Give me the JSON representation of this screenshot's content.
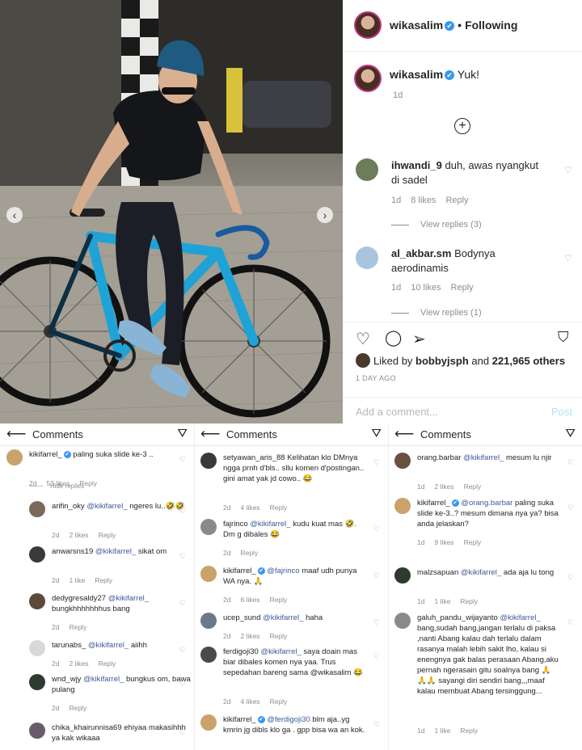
{
  "post": {
    "username": "wikasalim",
    "verified_glyph": "✔",
    "dot": "•",
    "following_label": "Following",
    "caption_text": "Yuk!",
    "caption_time": "1d",
    "load_more_glyph": "+",
    "comments": [
      {
        "user": "ihwandi_9",
        "text": "duh, awas nyangkut di sadel",
        "time": "1d",
        "likes": "8 likes",
        "reply": "Reply",
        "replies": "View replies (3)",
        "avatar_color": "#6b7d5a"
      },
      {
        "user": "al_akbar.sm",
        "text": "Bodynya aerodinamis",
        "time": "1d",
        "likes": "10 likes",
        "reply": "Reply",
        "replies": "View replies (1)",
        "avatar_color": "#a9c4de"
      }
    ],
    "liked_by_prefix": "Liked by",
    "liked_by_user": "bobbyjsph",
    "liked_by_and": "and",
    "liked_by_count": "221,965 others",
    "time_ago": "1 DAY AGO",
    "add_comment_placeholder": "Add a comment...",
    "post_button": "Post"
  },
  "carousel": {
    "prev": "‹",
    "next": "›"
  },
  "icons": {
    "heart": "heart-icon",
    "comment": "comment-icon",
    "share": "share-icon",
    "save": "bookmark-icon",
    "back": "back-arrow-icon",
    "send": "direct-send-icon"
  },
  "panels": [
    {
      "title": "Comments",
      "hide_replies": "Hide replies",
      "comments": [
        {
          "user": "kikifarrel_",
          "verified": true,
          "mention": "",
          "text": "paling suka slide ke-3 ..",
          "time": "2d",
          "likes": "53 likes",
          "reply": "Reply",
          "avatar_color": "#c9a36b"
        },
        {
          "user": "arifin_oky",
          "verified": false,
          "mention": "@kikifarrel_",
          "text": "ngeres lu..🤣🤣",
          "time": "2d",
          "likes": "2 likes",
          "reply": "Reply",
          "avatar_color": "#7a6a5a"
        },
        {
          "user": "anwarsns19",
          "verified": false,
          "mention": "@kikifarrel_",
          "text": "sikat om",
          "time": "2d",
          "likes": "1 like",
          "reply": "Reply",
          "avatar_color": "#3a3a3a"
        },
        {
          "user": "dedygresaldy27",
          "verified": false,
          "mention": "@kikifarrel_",
          "text": "bungkhhhhhhhus bang",
          "time": "2d",
          "likes": "",
          "reply": "Reply",
          "avatar_color": "#5a4a3a"
        },
        {
          "user": "tarunabs_",
          "verified": false,
          "mention": "@kikifarrel_",
          "text": "aiihh",
          "time": "2d",
          "likes": "2 likes",
          "reply": "Reply",
          "avatar_color": "#d8d8d8"
        },
        {
          "user": "wnd_wjy",
          "verified": false,
          "mention": "@kikifarrel_",
          "text": "bungkus om, bawa pulang",
          "time": "2d",
          "likes": "",
          "reply": "Reply",
          "avatar_color": "#2f3a2f"
        },
        {
          "user": "chika_khairunnisa69",
          "verified": false,
          "mention": "",
          "text": "ehiyaa makasihhh ya kak wikaaa",
          "time": "",
          "likes": "",
          "reply": "",
          "avatar_color": "#6a5a6a"
        }
      ]
    },
    {
      "title": "Comments",
      "comments": [
        {
          "user": "setyawan_aris_88",
          "verified": false,
          "mention": "",
          "text": "Kelihatan klo DMnya ngga prnh d'bls.. sllu komen d'postingan.. gini amat yak jd cowo.. 😂",
          "time": "2d",
          "likes": "4 likes",
          "reply": "Reply",
          "avatar_color": "#3a3a3a"
        },
        {
          "user": "fajrinco",
          "verified": false,
          "mention": "@kikifarrel_",
          "text": "kudu kuat mas 🤣. Dm g dibales 😂",
          "time": "2d",
          "likes": "",
          "reply": "Reply",
          "avatar_color": "#8a8a8a"
        },
        {
          "user": "kikifarrel_",
          "verified": true,
          "mention": "@fajrinco",
          "text": "maaf udh punya WA nya. 🙏",
          "time": "2d",
          "likes": "6 likes",
          "reply": "Reply",
          "avatar_color": "#c9a36b"
        },
        {
          "user": "ucep_sund",
          "verified": false,
          "mention": "@kikifarrel_",
          "text": "haha",
          "time": "2d",
          "likes": "2 likes",
          "reply": "Reply",
          "avatar_color": "#6a7a8a"
        },
        {
          "user": "ferdigoji30",
          "verified": false,
          "mention": "@kikifarrel_",
          "text": "saya doain mas biar dibales komen nya yaa. Trus sepedahan bareng sama @wikasalim 😂",
          "time": "2d",
          "likes": "4 likes",
          "reply": "Reply",
          "avatar_color": "#4a4a4a"
        },
        {
          "user": "kikifarrel_",
          "verified": true,
          "mention": "@ferdigoji30",
          "text": "blm aja..yg kmrin jg dibls klo ga . gpp bisa wa an kok.",
          "time": "",
          "likes": "",
          "reply": "",
          "avatar_color": "#c9a36b"
        }
      ]
    },
    {
      "title": "Comments",
      "comments": [
        {
          "user": "orang.barbar",
          "verified": false,
          "mention": "@kikifarrel_",
          "text": "mesum lu njir",
          "time": "1d",
          "likes": "2 likes",
          "reply": "Reply",
          "avatar_color": "#6a5040"
        },
        {
          "user": "kikifarrel_",
          "verified": true,
          "mention": "@orang.barbar",
          "text": "paling suka slide ke-3..? mesum dimana nya ya? bisa anda jelaskan?",
          "time": "1d",
          "likes": "9 likes",
          "reply": "Reply",
          "avatar_color": "#c9a36b"
        },
        {
          "user": "malzsapuan",
          "verified": false,
          "mention": "@kikifarrel_",
          "text": "ada aja lu tong",
          "time": "1d",
          "likes": "1 like",
          "reply": "Reply",
          "avatar_color": "#2f3a2f"
        },
        {
          "user": "galuh_pandu_wijayanto",
          "verified": false,
          "mention": "@kikifarrel_",
          "text": "bang,sudah bang,jangan terlalu di paksa ,nanti Abang kalau dah terlalu dalam rasanya malah lebih sakit lho, kalau si enengnya gak balas perasaan Abang,aku pernah ngerasain gitu soalnya bang 🙏🙏🙏 sayangi diri sendiri bang,,,maaf kalau membuat Abang tersinggung...",
          "time": "1d",
          "likes": "1 like",
          "reply": "Reply",
          "avatar_color": "#8a8a8a"
        }
      ]
    }
  ]
}
